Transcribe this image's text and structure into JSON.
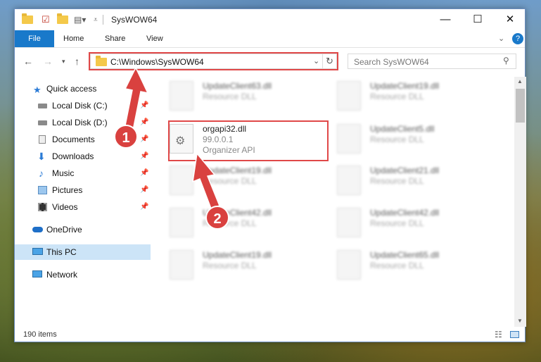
{
  "window": {
    "title": "SysWOW64",
    "controls": {
      "minimize": "—",
      "maximize": "☐",
      "close": "✕"
    }
  },
  "ribbon": {
    "tabs": [
      "File",
      "Home",
      "Share",
      "View"
    ]
  },
  "navigation": {
    "address": "C:\\Windows\\SysWOW64",
    "search_placeholder": "Search SysWOW64"
  },
  "sidebar": {
    "items": [
      {
        "label": "Quick access",
        "icon": "star-icon"
      },
      {
        "label": "Local Disk (C:)",
        "icon": "drive-icon",
        "pinned": true
      },
      {
        "label": "Local Disk (D:)",
        "icon": "drive-icon",
        "pinned": true
      },
      {
        "label": "Documents",
        "icon": "documents-icon",
        "pinned": true
      },
      {
        "label": "Downloads",
        "icon": "download-icon",
        "pinned": true
      },
      {
        "label": "Music",
        "icon": "music-icon",
        "pinned": true
      },
      {
        "label": "Pictures",
        "icon": "pictures-icon",
        "pinned": true
      },
      {
        "label": "Videos",
        "icon": "videos-icon",
        "pinned": true
      },
      {
        "label": "OneDrive",
        "icon": "cloud-icon"
      },
      {
        "label": "This PC",
        "icon": "computer-icon",
        "selected": true
      },
      {
        "label": "Network",
        "icon": "network-icon"
      }
    ]
  },
  "files": [
    {
      "name": "UpdateClient63.dll",
      "type": "Resource DLL"
    },
    {
      "name": "UpdateClient19.dll",
      "type": "Resource DLL"
    },
    {
      "name": "orgapi32.dll",
      "version": "99.0.0.1",
      "type": "Organizer API",
      "highlighted": true
    },
    {
      "name": "UpdateClient5.dll",
      "type": "Resource DLL"
    },
    {
      "name": "UpdateClient19.dll",
      "type": "Resource DLL"
    },
    {
      "name": "UpdateClient21.dll",
      "type": "Resource DLL"
    },
    {
      "name": "UpdateClient42.dll",
      "type": "Resource DLL"
    },
    {
      "name": "UpdateClient42.dll",
      "type": "Resource DLL"
    },
    {
      "name": "UpdateClient19.dll",
      "type": "Resource DLL"
    },
    {
      "name": "UpdateClient65.dll",
      "type": "Resource DLL"
    }
  ],
  "status": {
    "item_count": "190 items"
  },
  "annotations": {
    "step1": "1",
    "step2": "2",
    "color": "#d9413f"
  }
}
